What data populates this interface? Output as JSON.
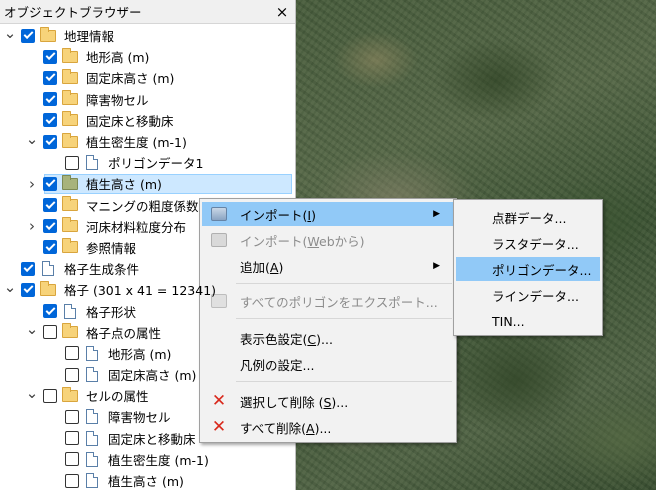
{
  "panel": {
    "title": "オブジェクトブラウザー",
    "close": "×"
  },
  "tree": [
    {
      "label": "地理情報",
      "indent": 0,
      "expander": "expanded",
      "checkbox": "on",
      "icon": "folder"
    },
    {
      "label": "地形高 (m)",
      "indent": 1,
      "expander": "none",
      "checkbox": "on",
      "icon": "folder"
    },
    {
      "label": "固定床高さ (m)",
      "indent": 1,
      "expander": "none",
      "checkbox": "on",
      "icon": "folder"
    },
    {
      "label": "障害物セル",
      "indent": 1,
      "expander": "none",
      "checkbox": "on",
      "icon": "folder"
    },
    {
      "label": "固定床と移動床",
      "indent": 1,
      "expander": "none",
      "checkbox": "on",
      "icon": "folder"
    },
    {
      "label": "植生密生度 (m-1)",
      "indent": 1,
      "expander": "expanded",
      "checkbox": "on",
      "icon": "folder"
    },
    {
      "label": "ポリゴンデータ1",
      "indent": 2,
      "expander": "none",
      "checkbox": "off",
      "icon": "doc"
    },
    {
      "label": "植生高さ (m)",
      "indent": 1,
      "expander": "collapsed",
      "checkbox": "on",
      "icon": "folder-green",
      "selected": true
    },
    {
      "label": "マニングの粗度係数",
      "indent": 1,
      "expander": "none",
      "checkbox": "on",
      "icon": "folder"
    },
    {
      "label": "河床材料粒度分布",
      "indent": 1,
      "expander": "collapsed",
      "checkbox": "on",
      "icon": "folder"
    },
    {
      "label": "参照情報",
      "indent": 1,
      "expander": "none",
      "checkbox": "on",
      "icon": "folder"
    },
    {
      "label": "格子生成条件",
      "indent": 0,
      "expander": "none",
      "checkbox": "on",
      "icon": "doc"
    },
    {
      "label": "格子 (301 x 41 = 12341)",
      "indent": 0,
      "expander": "expanded",
      "checkbox": "on",
      "icon": "folder"
    },
    {
      "label": "格子形状",
      "indent": 1,
      "expander": "none",
      "checkbox": "on",
      "icon": "doc"
    },
    {
      "label": "格子点の属性",
      "indent": 1,
      "expander": "expanded",
      "checkbox": "off",
      "icon": "folder"
    },
    {
      "label": "地形高 (m)",
      "indent": 2,
      "expander": "none",
      "checkbox": "off",
      "icon": "doc"
    },
    {
      "label": "固定床高さ (m)",
      "indent": 2,
      "expander": "none",
      "checkbox": "off",
      "icon": "doc"
    },
    {
      "label": "セルの属性",
      "indent": 1,
      "expander": "expanded",
      "checkbox": "off",
      "icon": "folder"
    },
    {
      "label": "障害物セル",
      "indent": 2,
      "expander": "none",
      "checkbox": "off",
      "icon": "doc"
    },
    {
      "label": "固定床と移動床",
      "indent": 2,
      "expander": "none",
      "checkbox": "off",
      "icon": "doc"
    },
    {
      "label": "植生密生度 (m-1)",
      "indent": 2,
      "expander": "none",
      "checkbox": "off",
      "icon": "doc"
    },
    {
      "label": "植生高さ (m)",
      "indent": 2,
      "expander": "none",
      "checkbox": "off",
      "icon": "doc"
    }
  ],
  "context_menu": {
    "import": {
      "text": "インポート(",
      "key": "I",
      "close": ")",
      "icon": "import-icon"
    },
    "import_web": {
      "text": "インポート(",
      "key": "W",
      "rest": "ebから)",
      "icon": "import-icon"
    },
    "add": {
      "text": "追加(",
      "key": "A",
      "close": ")"
    },
    "export_all": {
      "text": "すべてのポリゴンをエクスポート..."
    },
    "color_setting": {
      "text": "表示色設定(",
      "key": "C",
      "close": ")..."
    },
    "legend": {
      "text": "凡例の設定..."
    },
    "delete_selected": {
      "text": "選択して削除 (",
      "key": "S",
      "close": ")...",
      "icon": "delete-icon"
    },
    "delete_all": {
      "text": "すべて削除(",
      "key": "A",
      "close": ")...",
      "icon": "delete-icon"
    },
    "arrow": "▶",
    "icon_color_delete": "#d9291c",
    "highlight_color": "#91c9f7"
  },
  "submenu": [
    {
      "label": "点群データ..."
    },
    {
      "label": "ラスタデータ..."
    },
    {
      "label": "ポリゴンデータ...",
      "highlighted": true
    },
    {
      "label": "ラインデータ..."
    },
    {
      "label": "TIN..."
    }
  ]
}
